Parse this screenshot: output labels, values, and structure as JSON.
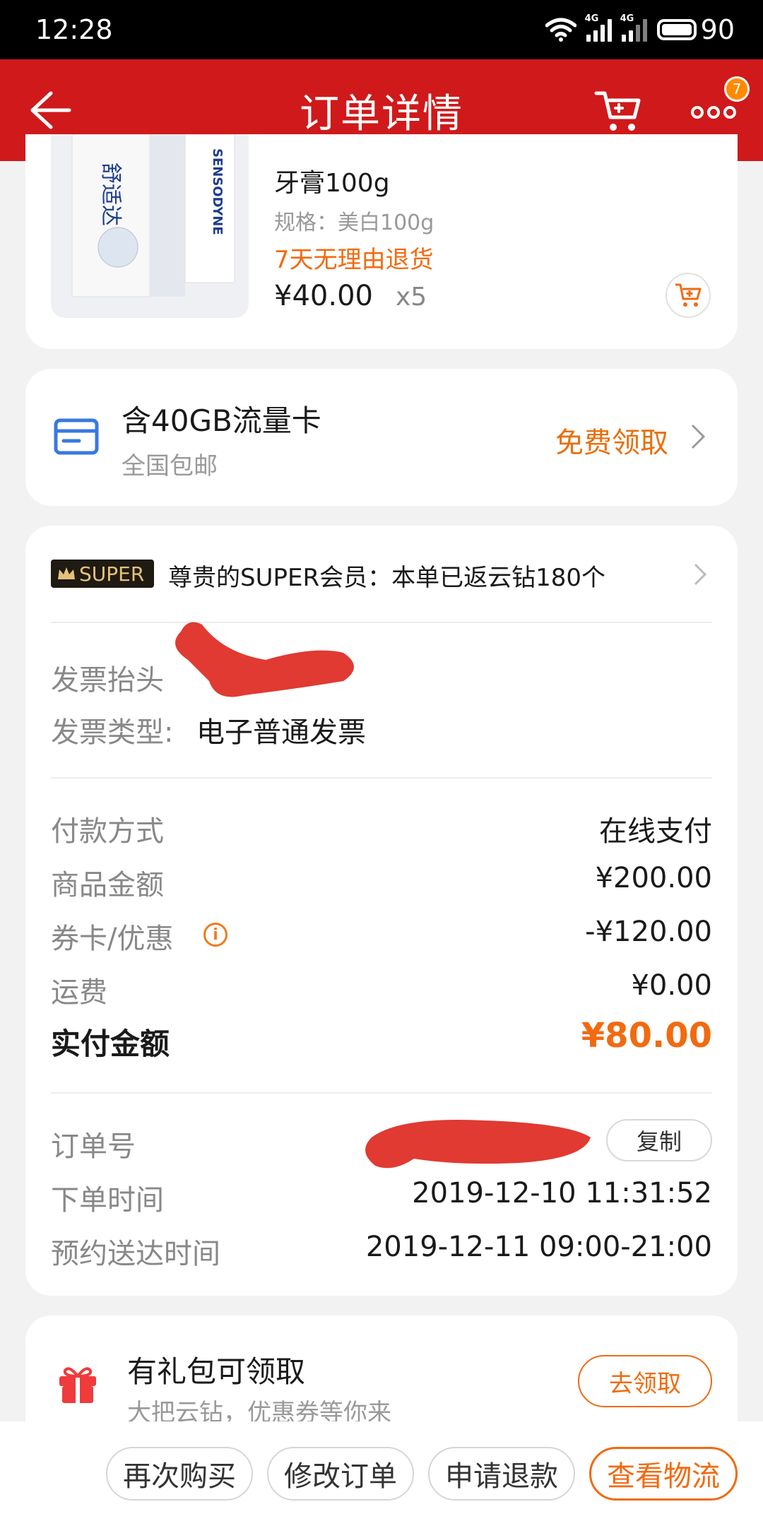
{
  "status_bar": {
    "time": "12:28",
    "network_1": "4G",
    "network_2": "4G",
    "battery": "90"
  },
  "header": {
    "title": "订单详情",
    "badge_count": "7"
  },
  "product": {
    "name": "牙膏100g",
    "spec": "规格：美白100g",
    "return_policy": "7天无理由退货",
    "price": "¥40.00",
    "quantity": "x5"
  },
  "sim_card": {
    "title": "含40GB流量卡",
    "subtitle": "全国包邮",
    "action": "免费领取"
  },
  "super": {
    "logo_text": "SUPER",
    "message": "尊贵的SUPER会员：本单已返云钻180个"
  },
  "invoice": {
    "title_label": "发票抬头",
    "type_label": "发票类型:",
    "type_value": "电子普通发票"
  },
  "payment": {
    "rows": [
      {
        "label": "付款方式",
        "value": "在线支付"
      },
      {
        "label": "商品金额",
        "value": "¥200.00"
      },
      {
        "label": "券卡/优惠",
        "value": "-¥120.00"
      },
      {
        "label": "运费",
        "value": "¥0.00"
      }
    ],
    "total_label": "实付金额",
    "total_value": "¥80.00"
  },
  "order": {
    "number_label": "订单号",
    "copy_label": "复制",
    "time_label": "下单时间",
    "time_value": "2019-12-10 11:31:52",
    "delivery_label": "预约送达时间",
    "delivery_value": "2019-12-11 09:00-21:00"
  },
  "gift": {
    "title": "有礼包可领取",
    "subtitle": "大把云钻，优惠券等你来",
    "button": "去领取"
  },
  "bottom_bar": {
    "buy_again": "再次购买",
    "modify_order": "修改订单",
    "refund": "申请退款",
    "logistics": "查看物流"
  },
  "colors": {
    "brand_red": "#d0191b",
    "accent_orange": "#f26a10"
  }
}
